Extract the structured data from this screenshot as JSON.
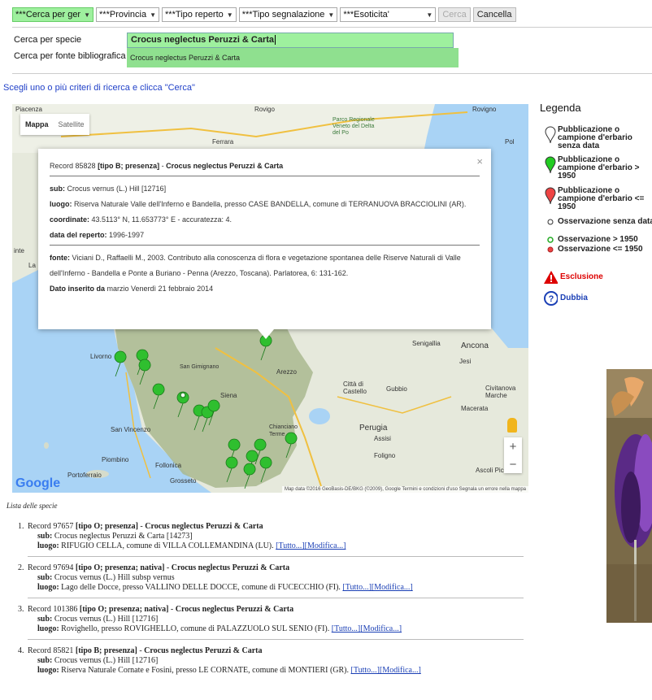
{
  "filters": {
    "search_by": "***Cerca per ger",
    "province": "***Provincia",
    "type_record": "***Tipo reperto",
    "type_report": "***Tipo segnalazione",
    "exoticity": "***Esoticita'",
    "search_btn": "Cerca",
    "cancel_btn": "Cancella"
  },
  "search": {
    "species_label": "Cerca per specie",
    "species_value": "Crocus neglectus Peruzzi & Carta",
    "biblio_label": "Cerca per fonte bibliografica",
    "suggestion": "Crocus neglectus Peruzzi & Carta"
  },
  "hint": "Scegli uno o più criteri di ricerca e clicca \"Cerca\"",
  "map": {
    "type_map": "Mappa",
    "type_satellite": "Satellite",
    "logo": "Google",
    "attribution": "Map data ©2016 GeoBasis-DE/BKG (©2009), Google   Termini e condizioni d'uso   Segnala un errore nella mappa",
    "places": [
      "Piacenza",
      "Rovigo",
      "Ferrara",
      "Parco Regionale Veneto del Delta del Po",
      "Pol",
      "Senigallia",
      "Ancona",
      "Jesi",
      "Livorno",
      "Arezzo",
      "Città di Castello",
      "Gubbio",
      "Civitanova Marche",
      "Macerata",
      "Siena",
      "San Gimignano",
      "Perugia",
      "Assisi",
      "Foligno",
      "San Vincenzo",
      "Chianciano Terme",
      "Piombino",
      "Follonica",
      "Portoferraio",
      "Grosseto",
      "Ascoli Pice",
      "Rovigno",
      "inte",
      "La"
    ],
    "infowindow": {
      "record_id": "Record 85828",
      "type_text": "[tipo B; presenza]",
      "species": "Crocus neglectus Peruzzi & Carta",
      "sub_label": "sub:",
      "sub_value": "Crocus vernus (L.) Hill [12716]",
      "luogo_label": "luogo:",
      "luogo_value": "Riserva Naturale Valle dell'Inferno e Bandella, presso CASE BANDELLA, comune di TERRANUOVA BRACCIOLINI (AR).",
      "coord_label": "coordinate:",
      "coord_value": "43.5113° N, 11.653773° E - accuratezza: 4.",
      "date_label": "data del reperto:",
      "date_value": "1996-1997",
      "fonte_label": "fonte:",
      "fonte_value": "Viciani D., Raffaelli M., 2003. Contributo alla conoscenza di flora e vegetazione spontanea delle Riserve Naturali di Valle dell'Inferno - Bandella e Ponte a Buriano - Penna (Arezzo, Toscana). Parlatorea, 6: 131-162.",
      "inserted_label": "Dato inserito da",
      "inserted_value": "marzio Venerdì 21 febbraio 2014",
      "close": "×"
    }
  },
  "legend": {
    "title": "Legenda",
    "items": [
      {
        "label": "Pubblicazione o campione d'erbario senza data",
        "color": "#ffffff"
      },
      {
        "label": "Pubblicazione o campione d'erbario > 1950",
        "color": "#22cc22"
      },
      {
        "label": "Pubblicazione o campione d'erbario <= 1950",
        "color": "#ee4444"
      },
      {
        "label": "Osservazione senza data",
        "color": "#ffffff"
      },
      {
        "label": "Osservazione > 1950",
        "color": "#22cc22"
      },
      {
        "label": "Osservazione <= 1950",
        "color": "#ee4444"
      },
      {
        "label": "Esclusione",
        "color": "#dd0000"
      },
      {
        "label": "Dubbia",
        "color": "#1a3fb5"
      }
    ]
  },
  "list": {
    "title": "Lista delle specie",
    "records": [
      {
        "num": "1.",
        "head": "Record 97657",
        "type": "[tipo O; presenza]",
        "species": "Crocus neglectus Peruzzi & Carta",
        "sub": "Crocus neglectus Peruzzi & Carta [14273]",
        "luogo": "RIFUGIO CELLA, comune di VILLA COLLEMANDINA (LU).",
        "link1": "[Tutto...]",
        "link2": "[Modifica...]"
      },
      {
        "num": "2.",
        "head": "Record 97694",
        "type": "[tipo O; presenza; nativa]",
        "species": "Crocus neglectus Peruzzi & Carta",
        "sub": "Crocus vernus (L.) Hill subsp vernus",
        "luogo": "Lago delle Docce, presso VALLINO DELLE DOCCE, comune di FUCECCHIO (FI).",
        "link1": "[Tutto...]",
        "link2": "[Modifica...]"
      },
      {
        "num": "3.",
        "head": "Record 101386",
        "type": "[tipo O; presenza; nativa]",
        "species": "Crocus neglectus Peruzzi & Carta",
        "sub": "Crocus vernus (L.) Hill [12716]",
        "luogo": "Rovighello, presso ROVIGHELLO, comune di PALAZZUOLO SUL SENIO (FI).",
        "link1": "[Tutto...]",
        "link2": "[Modifica...]"
      },
      {
        "num": "4.",
        "head": "Record 85821",
        "type": "[tipo B; presenza]",
        "species": "Crocus neglectus Peruzzi & Carta",
        "sub": "Crocus vernus (L.) Hill [12716]",
        "luogo": "Riserva Naturale Cornate e Fosini, presso LE CORNATE, comune di MONTIERI (GR).",
        "link1": "[Tutto...]",
        "link2": "[Modifica...]"
      }
    ],
    "sub_label": "sub:",
    "luogo_label": "luogo:"
  }
}
